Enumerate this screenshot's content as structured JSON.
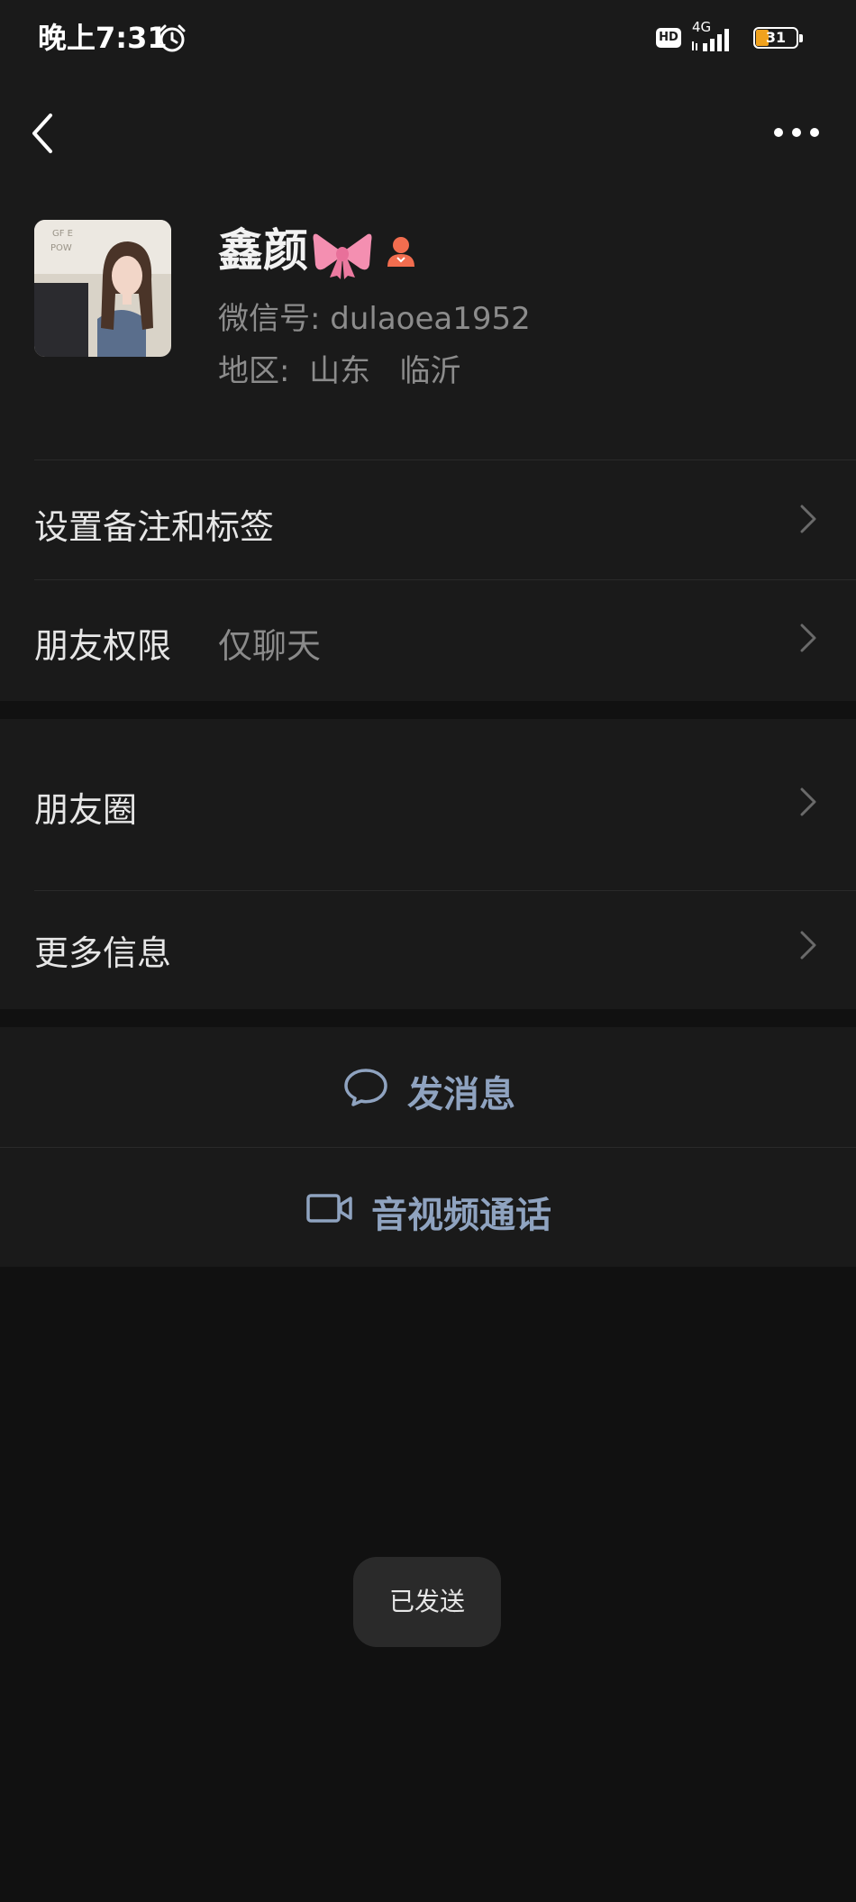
{
  "status_bar": {
    "time": "晚上7:31",
    "hd_badge": "HD",
    "network": "4G",
    "battery": "31"
  },
  "header": {
    "back_icon": "chevron-left-icon",
    "more_icon": "more-dots-icon"
  },
  "profile": {
    "name": "鑫颜",
    "name_emoji": "ribbon-bow-icon",
    "gender_icon": "female-icon",
    "wechat_id": "微信号:  dulaoea1952",
    "region": "地区:  山东   临沂"
  },
  "settings": {
    "remark_label": "设置备注和标签",
    "permission_label": "朋友权限",
    "permission_value": "仅聊天"
  },
  "info": {
    "moments_label": "朋友圈",
    "more_info_label": "更多信息"
  },
  "actions": {
    "message_label": "发消息",
    "call_label": "音视频通话"
  },
  "toast": {
    "text": "已发送"
  },
  "colors": {
    "background": "#111111",
    "panel": "#1a1a1a",
    "action_text": "#8fa3c0",
    "battery_fill": "#f0a21e"
  }
}
